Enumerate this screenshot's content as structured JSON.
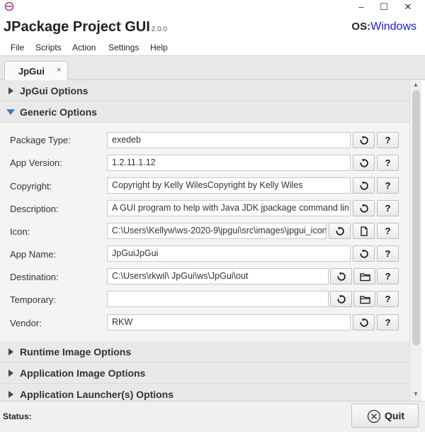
{
  "window": {
    "minimize": "–",
    "maximize": "☐",
    "close": "✕"
  },
  "header": {
    "title": "JPackage Project GUI",
    "version": "2.0.0",
    "os_label": "OS:",
    "os_value": "Windows"
  },
  "menu": [
    "File",
    "Scripts",
    "Action",
    "Settings",
    "Help"
  ],
  "tab": {
    "label": "JpGui",
    "close": "×"
  },
  "sections": {
    "jpgui_options": "JpGui Options",
    "generic_options": "Generic Options",
    "runtime_image_options": "Runtime Image Options",
    "application_image_options": "Application Image Options",
    "application_launcher_options": "Application Launcher(s) Options"
  },
  "form": {
    "package_type": {
      "label": "Package Type:",
      "value": "exedeb"
    },
    "app_version": {
      "label": "App Version:",
      "value": "1.2.11.1.12"
    },
    "copyright": {
      "label": "Copyright:",
      "value": "Copyright by Kelly WilesCopyright by Kelly Wiles"
    },
    "description": {
      "label": "Description:",
      "value": "A GUI program to help with Java JDK jpackage command lin"
    },
    "icon": {
      "label": "Icon:",
      "value": "C:\\Users\\Kellyw\\ws-2020-9\\jpgui\\src\\images\\jpgui_icon"
    },
    "app_name": {
      "label": "App Name:",
      "value": "JpGuiJpGui"
    },
    "destination": {
      "label": "Destination:",
      "value": "C:\\Users\\rkwil\\ JpGui\\ws\\JpGui\\out"
    },
    "temporary": {
      "label": "Temporary:",
      "value": ""
    },
    "vendor": {
      "label": "Vendor:",
      "value": "RKW"
    }
  },
  "buttons": {
    "help": "?"
  },
  "status": {
    "label": "Status:"
  },
  "quit": {
    "label": "Quit"
  },
  "colors": {
    "os_value": "#1a1adf",
    "expanded_arrow": "#3c7fc0"
  }
}
